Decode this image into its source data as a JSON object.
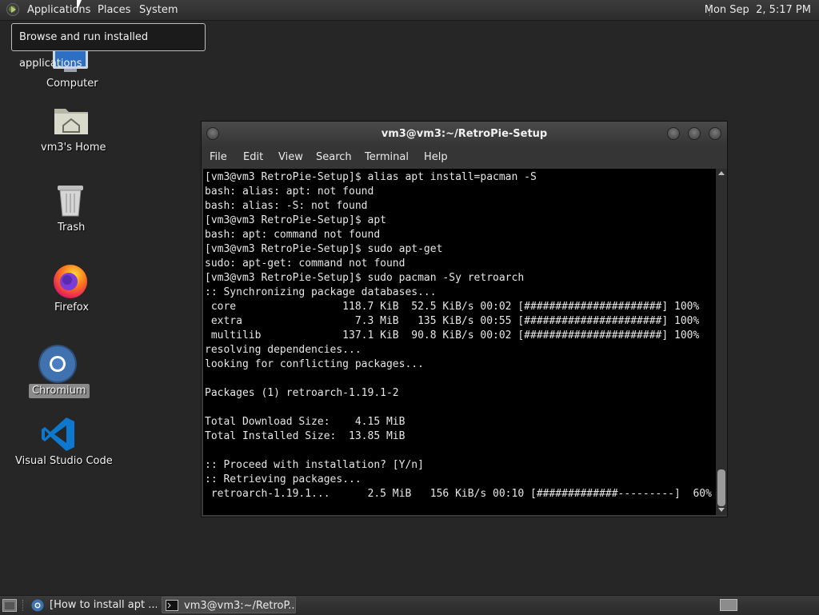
{
  "top_panel": {
    "menus": [
      "Applications",
      "Places",
      "System"
    ],
    "clock": "Mon Sep  2, 5:17 PM"
  },
  "tooltip": "Browse and run installed applications",
  "desktop_icons": [
    {
      "label": "Computer",
      "icon": "computer-icon"
    },
    {
      "label": "vm3's Home",
      "icon": "home-folder-icon"
    },
    {
      "label": "Trash",
      "icon": "trash-icon"
    },
    {
      "label": "Firefox",
      "icon": "firefox-icon"
    },
    {
      "label": "Chromium",
      "icon": "chromium-icon",
      "selected": true
    },
    {
      "label": "Visual Studio Code",
      "icon": "vscode-icon"
    }
  ],
  "terminal": {
    "title": "vm3@vm3:~/RetroPie-Setup",
    "menu": [
      "File",
      "Edit",
      "View",
      "Search",
      "Terminal",
      "Help"
    ],
    "lines": [
      "[vm3@vm3 RetroPie-Setup]$ alias apt install=pacman -S",
      "bash: alias: apt: not found",
      "bash: alias: -S: not found",
      "[vm3@vm3 RetroPie-Setup]$ apt",
      "bash: apt: command not found",
      "[vm3@vm3 RetroPie-Setup]$ sudo apt-get",
      "sudo: apt-get: command not found",
      "[vm3@vm3 RetroPie-Setup]$ sudo pacman -Sy retroarch",
      ":: Synchronizing package databases...",
      " core                 118.7 KiB  52.5 KiB/s 00:02 [######################] 100%",
      " extra                  7.3 MiB   135 KiB/s 00:55 [######################] 100%",
      " multilib             137.1 KiB  90.8 KiB/s 00:02 [######################] 100%",
      "resolving dependencies...",
      "looking for conflicting packages...",
      "",
      "Packages (1) retroarch-1.19.1-2",
      "",
      "Total Download Size:    4.15 MiB",
      "Total Installed Size:  13.85 MiB",
      "",
      ":: Proceed with installation? [Y/n]",
      ":: Retrieving packages...",
      " retroarch-1.19.1...      2.5 MiB   156 KiB/s 00:10 [#############---------]  60%"
    ],
    "scroll_position": 0.9
  },
  "taskbar": {
    "tasks": [
      {
        "label": "[How to install apt ...",
        "icon": "chromium-icon",
        "active": false
      },
      {
        "label": "vm3@vm3:~/RetroP...",
        "icon": "terminal-icon",
        "active": true
      }
    ]
  }
}
